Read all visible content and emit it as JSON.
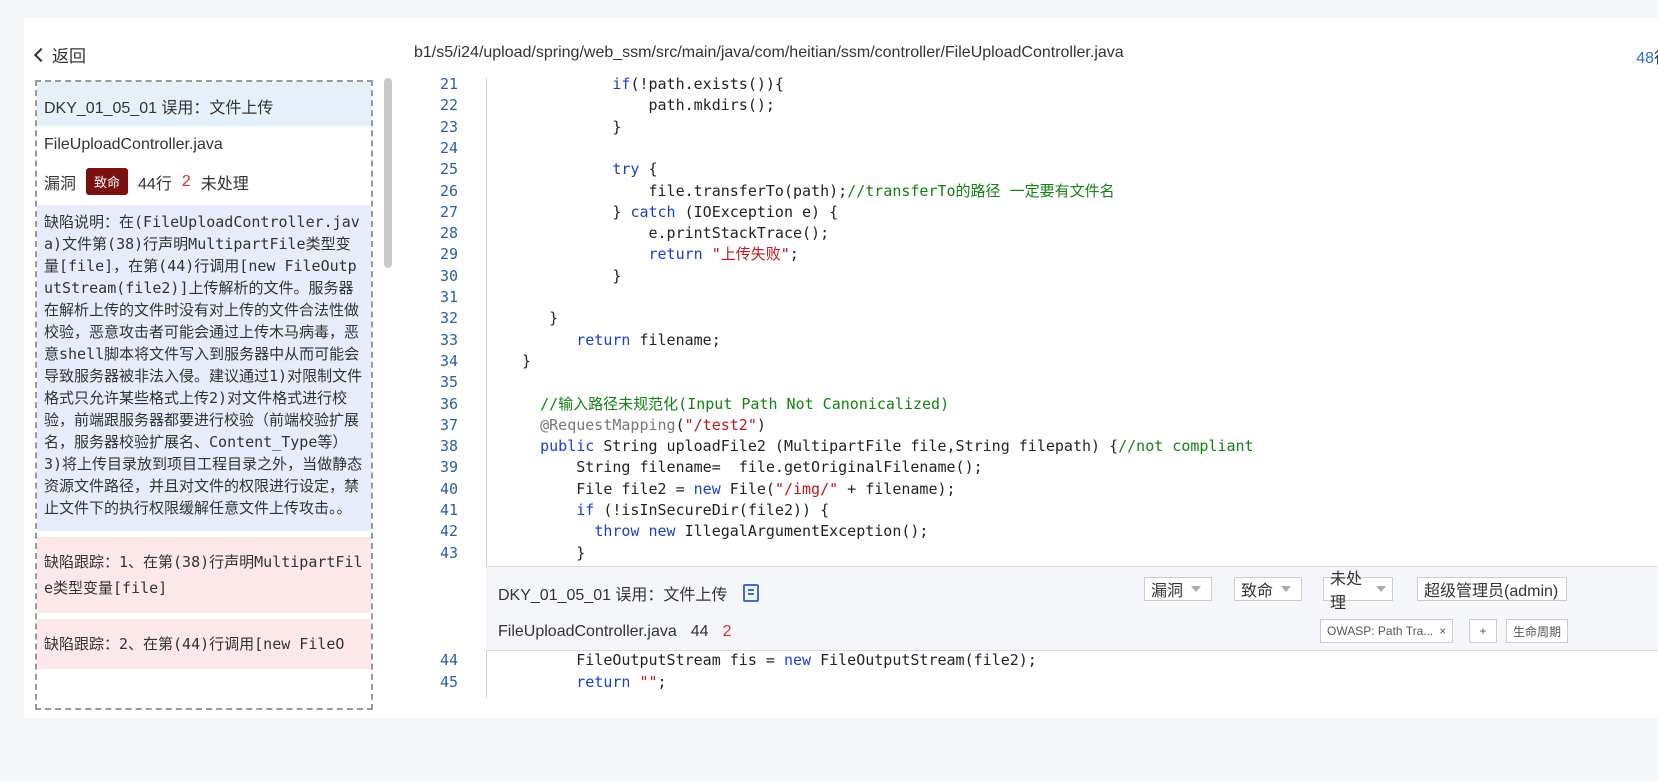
{
  "left_panel": {
    "back_label": "返回",
    "issue": {
      "title": "DKY_01_05_01 误用：文件上传",
      "file": "FileUploadController.java",
      "type": "漏洞",
      "severity": "致命",
      "line": "44行",
      "count": "2",
      "status": "未处理",
      "description": "缺陷说明：在(FileUploadController.java)文件第(38)行声明MultipartFile类型变量[file]，在第(44)行调用[new FileOutputStream(file2)]上传解析的文件。服务器在解析上传的文件时没有对上传的文件合法性做校验，恶意攻击者可能会通过上传木马病毒，恶意shell脚本将文件写入到服务器中从而可能会导致服务器被非法入侵。建议通过1)对限制文件格式只允许某些格式上传2)对文件格式进行校验，前端跟服务器都要进行校验（前端校验扩展名，服务器校验扩展名、Content_Type等）3)将上传目录放到项目工程目录之外，当做静态资源文件路径，并且对文件的权限进行设定，禁止文件下的执行权限缓解任意文件上传攻击。。",
      "trace1": "缺陷跟踪：1、在第(38)行声明MultipartFile类型变量[file]",
      "trace2": "缺陷跟踪：2、在第(44)行调用[new FileO"
    }
  },
  "right_panel": {
    "file_path": "b1/s5/i24/upload/spring/web_ssm/src/main/java/com/heitian/ssm/controller/FileUploadController.java",
    "line_count_num": "48",
    "line_count_suffix": "行",
    "code_lines": [
      {
        "n": "21",
        "t": "            if(!path.exists()){"
      },
      {
        "n": "22",
        "t": "                path.mkdirs();"
      },
      {
        "n": "23",
        "t": "            }"
      },
      {
        "n": "24",
        "t": ""
      },
      {
        "n": "25",
        "t": "            try {"
      },
      {
        "n": "26",
        "t": "                file.transferTo(path);//transferTo的路径 一定要有文件名"
      },
      {
        "n": "27",
        "t": "            } catch (IOException e) {"
      },
      {
        "n": "28",
        "t": "                e.printStackTrace();"
      },
      {
        "n": "29",
        "t": "                return \"上传失败\";"
      },
      {
        "n": "30",
        "t": "            }"
      },
      {
        "n": "31",
        "t": ""
      },
      {
        "n": "32",
        "t": "     }"
      },
      {
        "n": "33",
        "t": "        return filename;"
      },
      {
        "n": "34",
        "t": "  }"
      },
      {
        "n": "35",
        "t": ""
      },
      {
        "n": "36",
        "t": "    //输入路径未规范化(Input Path Not Canonicalized)"
      },
      {
        "n": "37",
        "t": "    @RequestMapping(\"/test2\")"
      },
      {
        "n": "38",
        "t": "    public String uploadFile2 (MultipartFile file,String filepath) {//not compliant"
      },
      {
        "n": "39",
        "t": "        String filename=  file.getOriginalFilename();"
      },
      {
        "n": "40",
        "t": "        File file2 = new File(\"/img/\" + filename);"
      },
      {
        "n": "41",
        "t": "        if (!isInSecureDir(file2)) {"
      },
      {
        "n": "42",
        "t": "          throw new IllegalArgumentException();"
      },
      {
        "n": "43",
        "t": "        }"
      }
    ],
    "code_lines_after": [
      {
        "n": "44",
        "t": "        FileOutputStream fis = new FileOutputStream(file2);"
      },
      {
        "n": "45",
        "t": "        return \"\";"
      }
    ],
    "popup": {
      "title": "DKY_01_05_01 误用：文件上传",
      "file": "FileUploadController.java",
      "line": "44",
      "count": "2",
      "type_select": "漏洞",
      "severity_select": "致命",
      "status_select": "未处理",
      "assignee_select": "超级管理员(admin)",
      "tag": "OWASP: Path Tra...",
      "tag_close": "×",
      "add_button": "+",
      "lifecycle": "生命周期"
    }
  }
}
